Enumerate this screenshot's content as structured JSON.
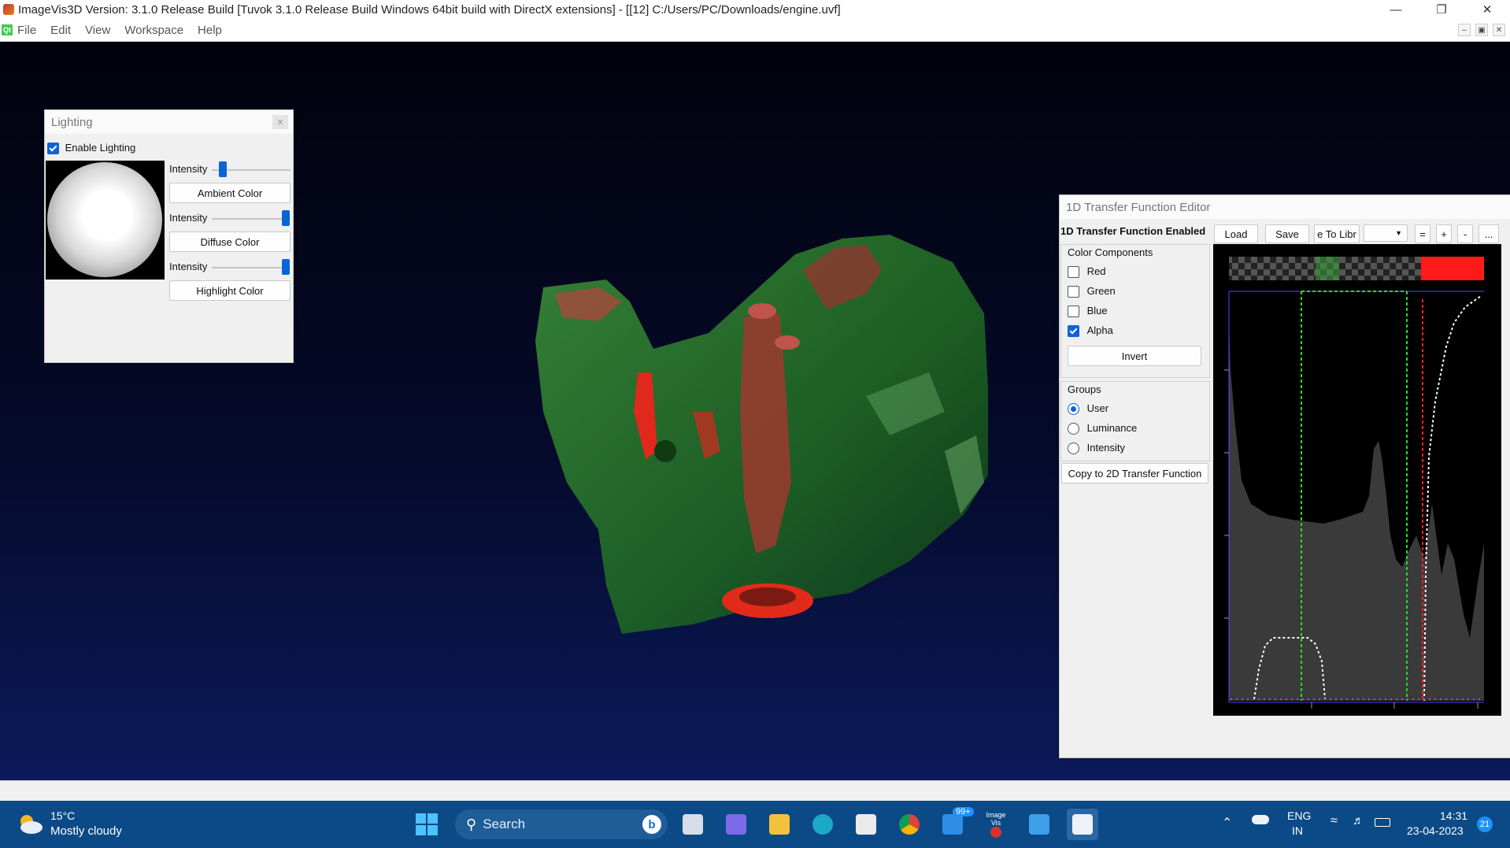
{
  "window": {
    "title": "ImageVis3D Version: 3.1.0 Release Build [Tuvok 3.1.0 Release Build Windows 64bit build with DirectX extensions] - [[12] C:/Users/PC/Downloads/engine.uvf]"
  },
  "menu": {
    "items": [
      "File",
      "Edit",
      "View",
      "Workspace",
      "Help"
    ]
  },
  "lighting": {
    "title": "Lighting",
    "enable_label": "Enable Lighting",
    "enabled": true,
    "intensity_label": "Intensity",
    "ambient_button": "Ambient Color",
    "diffuse_button": "Diffuse Color",
    "highlight_button": "Highlight Color",
    "ambient_intensity": 0.1,
    "diffuse_intensity": 1.0,
    "highlight_intensity": 1.0
  },
  "tf_editor": {
    "title": "1D Transfer Function Editor",
    "enabled_label": "1D Transfer Function Enabled",
    "load_button": "Load",
    "save_button": "Save",
    "save_to_lib_button": "e To Libr",
    "preset_value": "",
    "btn_equal": "=",
    "btn_plus": "+",
    "btn_minus": "-",
    "btn_more": "...",
    "color_components_label": "Color Components",
    "components": [
      {
        "label": "Red",
        "checked": false
      },
      {
        "label": "Green",
        "checked": false
      },
      {
        "label": "Blue",
        "checked": false
      },
      {
        "label": "Alpha",
        "checked": true
      }
    ],
    "invert_button": "Invert",
    "groups_label": "Groups",
    "groups": [
      {
        "label": "User",
        "checked": true
      },
      {
        "label": "Luminance",
        "checked": false
      },
      {
        "label": "Intensity",
        "checked": false
      }
    ],
    "copy_button": "Copy to 2D Transfer Function"
  },
  "taskbar": {
    "weather_temp": "15°C",
    "weather_desc": "Mostly cloudy",
    "search_placeholder": "Search",
    "mail_badge": "99+",
    "imagevis_label": "Image Vis",
    "lang_line1": "ENG",
    "lang_line2": "IN",
    "time": "14:31",
    "date": "23-04-2023",
    "notification_count": "21"
  },
  "colors": {
    "accent": "#0a64d8",
    "taskbar": "#0b4a86",
    "volume_green": "#2e8b2e",
    "volume_red": "#d42a1e"
  }
}
